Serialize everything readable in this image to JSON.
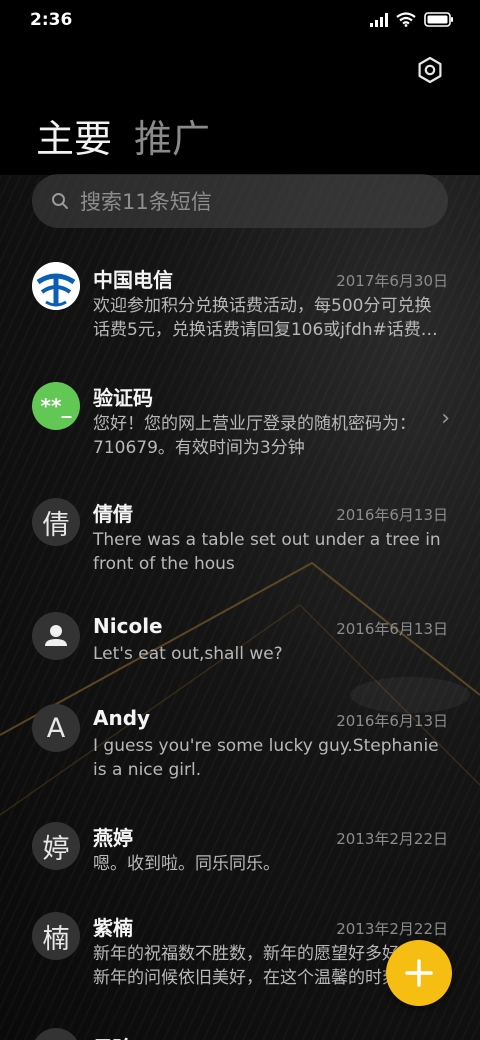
{
  "status_bar": {
    "time": "2:36"
  },
  "tabs": [
    {
      "label": "主要",
      "active": true
    },
    {
      "label": "推广",
      "active": false
    }
  ],
  "search": {
    "placeholder": "搜索11条短信"
  },
  "conversations": [
    {
      "name": "中国电信",
      "date": "2017年6月30日",
      "preview": "欢迎参加积分兑换话费活动，每500分可兑换话费5元，兑换话费请回复106或jfdh#话费…",
      "avatar": "china-telecom-logo"
    },
    {
      "name": "验证码",
      "date": "",
      "preview": "您好！您的网上营业厅登录的随机密码为：710679。有效时间为3分钟",
      "avatar_text": "**_"
    },
    {
      "name": "倩倩",
      "date": "2016年6月13日",
      "preview": "There was a table set out under a tree in front of the hous",
      "avatar_text": "倩"
    },
    {
      "name": "Nicole",
      "date": "2016年6月13日",
      "preview": "Let's eat out,shall we?",
      "avatar": "person-icon"
    },
    {
      "name": "Andy",
      "date": "2016年6月13日",
      "preview": "I guess you're some lucky guy.Stephanie is a nice girl.",
      "avatar_text": "A"
    },
    {
      "name": "燕婷",
      "date": "2013年2月22日",
      "preview": "嗯。收到啦。同乐同乐。",
      "avatar_text": "婷"
    },
    {
      "name": "紫楠",
      "date": "2013年2月22日",
      "preview": "新年的祝福数不胜数，新年的愿望好多好多，新年的问候依旧美好，在这个温馨的时刻",
      "avatar_text": "楠"
    },
    {
      "name": "子玲",
      "avatar_text": "玲"
    }
  ],
  "colors": {
    "fab": "#f6bd12",
    "verify_avatar": "#63c755",
    "telecom_blue": "#0a5fb4"
  }
}
